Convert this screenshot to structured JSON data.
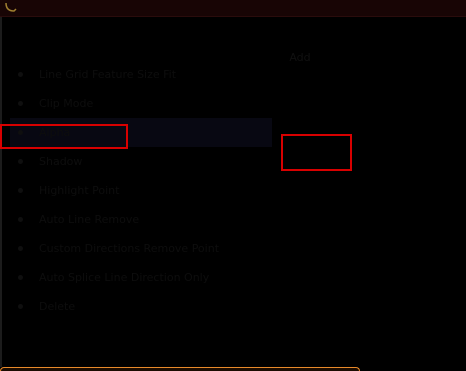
{
  "window": {
    "title": "",
    "column_header": "Add"
  },
  "menu": {
    "items": [
      {
        "label": "Line Grid Feature Size Fit"
      },
      {
        "label": "Clip Mode"
      },
      {
        "label": "Alpha"
      },
      {
        "label": "Shadow"
      },
      {
        "label": "Highlight Point"
      },
      {
        "label": "Auto Line Remove"
      },
      {
        "label": "Custom Directions Remove Point"
      },
      {
        "label": "Auto Splice Line Direction Only"
      },
      {
        "label": "Delete"
      }
    ],
    "selected_index": 2
  },
  "highlights": {
    "color": "#d80000"
  },
  "colors": {
    "background": "#000000",
    "titlebar": "#180505",
    "accent_orange": "#e88a2a"
  }
}
